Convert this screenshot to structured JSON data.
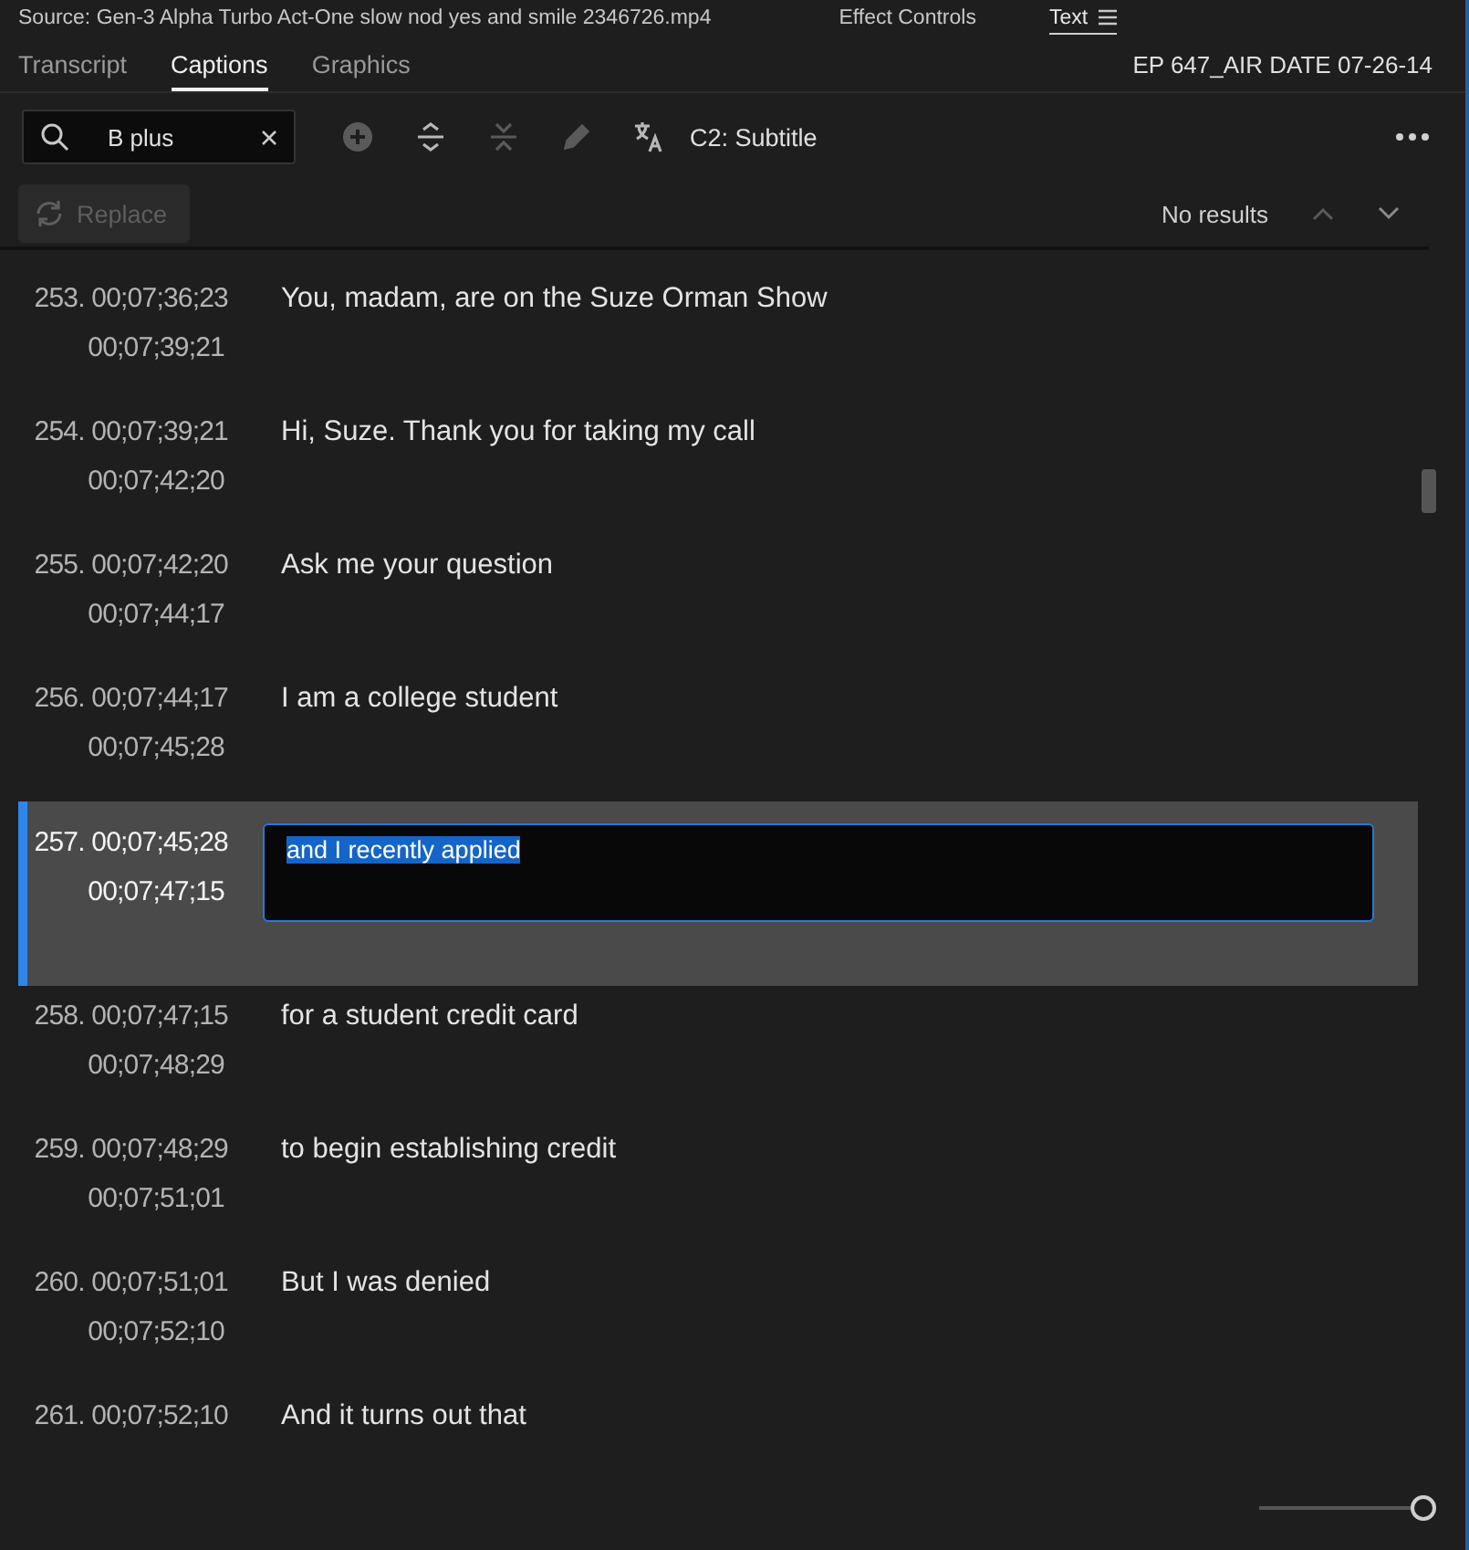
{
  "panel_tabs": [
    {
      "label": "Source: Gen-3 Alpha Turbo Act-One slow nod yes and smile 2346726.mp4",
      "selected": false
    },
    {
      "label": "Effect Controls",
      "selected": false
    },
    {
      "label": "Text",
      "selected": true
    }
  ],
  "text_tabs": [
    {
      "label": "Transcript",
      "selected": false
    },
    {
      "label": "Captions",
      "selected": true
    },
    {
      "label": "Graphics",
      "selected": false
    }
  ],
  "sequence_name": "EP 647_AIR DATE 07-26-14",
  "search": {
    "value": "B plus"
  },
  "tools": [
    {
      "kind": "add",
      "disabled": true
    },
    {
      "kind": "split",
      "disabled": false
    },
    {
      "kind": "merge",
      "disabled": true
    },
    {
      "kind": "edit",
      "disabled": true
    },
    {
      "kind": "translate",
      "disabled": false
    }
  ],
  "track": "C2: Subtitle",
  "replace_button": {
    "label": "Replace",
    "disabled": true
  },
  "results": "No results",
  "captions": [
    {
      "number": "253.",
      "start": "00;07;36;23",
      "end": "00;07;39;21",
      "text": "You, madam, are on the Suze Orman Show",
      "selected": false
    },
    {
      "number": "254.",
      "start": "00;07;39;21",
      "end": "00;07;42;20",
      "text": "Hi, Suze. Thank you for taking my call",
      "selected": false
    },
    {
      "number": "255.",
      "start": "00;07;42;20",
      "end": "00;07;44;17",
      "text": "Ask me your question",
      "selected": false
    },
    {
      "number": "256.",
      "start": "00;07;44;17",
      "end": "00;07;45;28",
      "text": "I am a college student",
      "selected": false
    },
    {
      "number": "257.",
      "start": "00;07;45;28",
      "end": "00;07;47;15",
      "text": "and I recently applied",
      "selected": true
    },
    {
      "number": "258.",
      "start": "00;07;47;15",
      "end": "00;07;48;29",
      "text": "for a student credit card",
      "selected": false
    },
    {
      "number": "259.",
      "start": "00;07;48;29",
      "end": "00;07;51;01",
      "text": "to begin establishing credit",
      "selected": false
    },
    {
      "number": "260.",
      "start": "00;07;51;01",
      "end": "00;07;52;10",
      "text": "But I was denied",
      "selected": false
    },
    {
      "number": "261.",
      "start": "00;07;52;10",
      "text": "And it turns out that",
      "selected": false
    }
  ],
  "zoom_slider": {
    "level": 1
  }
}
